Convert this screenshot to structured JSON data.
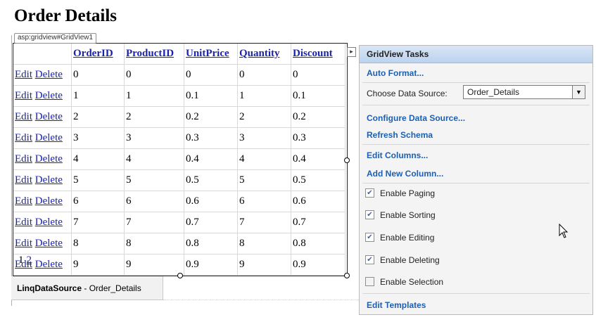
{
  "page": {
    "title": "Order Details"
  },
  "gridview": {
    "tag": "asp:gridview#GridView1",
    "columns": [
      "OrderID",
      "ProductID",
      "UnitPrice",
      "Quantity",
      "Discount"
    ],
    "edit_label": "Edit",
    "delete_label": "Delete",
    "rows": [
      [
        "0",
        "0",
        "0",
        "0",
        "0"
      ],
      [
        "1",
        "1",
        "0.1",
        "1",
        "0.1"
      ],
      [
        "2",
        "2",
        "0.2",
        "2",
        "0.2"
      ],
      [
        "3",
        "3",
        "0.3",
        "3",
        "0.3"
      ],
      [
        "4",
        "4",
        "0.4",
        "4",
        "0.4"
      ],
      [
        "5",
        "5",
        "0.5",
        "5",
        "0.5"
      ],
      [
        "6",
        "6",
        "0.6",
        "6",
        "0.6"
      ],
      [
        "7",
        "7",
        "0.7",
        "7",
        "0.7"
      ],
      [
        "8",
        "8",
        "0.8",
        "8",
        "0.8"
      ],
      [
        "9",
        "9",
        "0.9",
        "9",
        "0.9"
      ]
    ],
    "pager": {
      "current": "1",
      "next": "2"
    }
  },
  "datasource": {
    "type": "LinqDataSource",
    "separator": " - ",
    "id": "Order_Details"
  },
  "tasks_panel": {
    "title": "GridView Tasks",
    "auto_format": "Auto Format...",
    "choose_ds_label": "Choose Data Source:",
    "choose_ds_value": "Order_Details",
    "configure_ds": "Configure Data Source...",
    "refresh_schema": "Refresh Schema",
    "edit_columns": "Edit Columns...",
    "add_column": "Add New Column...",
    "options": [
      {
        "label": "Enable Paging",
        "checked": true
      },
      {
        "label": "Enable Sorting",
        "checked": true
      },
      {
        "label": "Enable Editing",
        "checked": true
      },
      {
        "label": "Enable Deleting",
        "checked": true
      },
      {
        "label": "Enable Selection",
        "checked": false
      }
    ],
    "edit_templates": "Edit Templates"
  }
}
